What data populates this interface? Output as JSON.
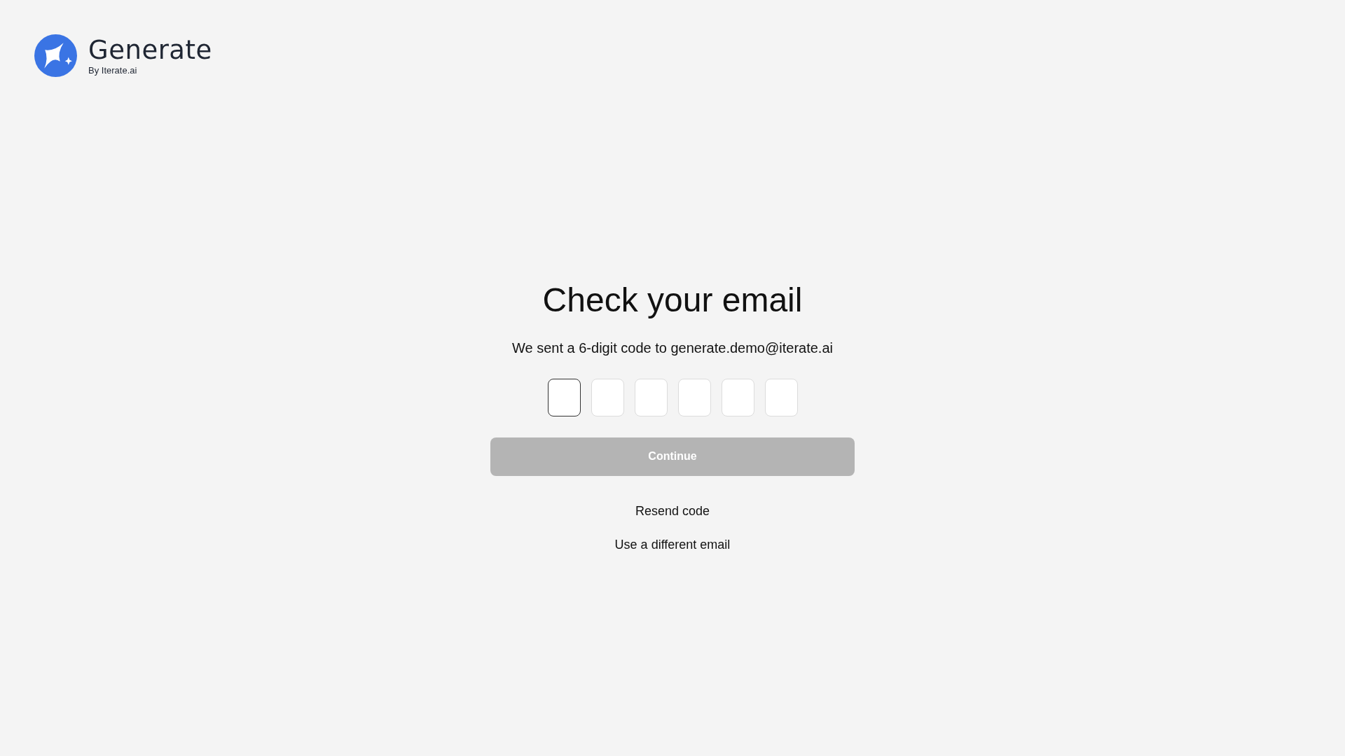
{
  "brand": {
    "name": "Generate",
    "tagline": "By Iterate.ai"
  },
  "title": "Check your email",
  "message": "We sent a 6-digit code to generate.demo@iterate.ai",
  "code_fields": [
    {
      "focused": true
    },
    {
      "focused": false
    },
    {
      "focused": false
    },
    {
      "focused": false
    },
    {
      "focused": false
    },
    {
      "focused": false
    }
  ],
  "continue_button": {
    "label": "Continue",
    "disabled": true
  },
  "links": [
    "Resend code",
    "Use a different email"
  ]
}
